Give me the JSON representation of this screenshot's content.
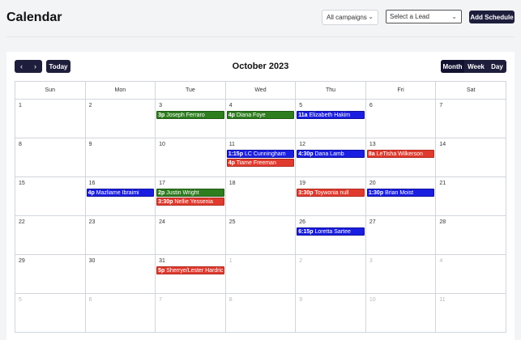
{
  "header": {
    "title": "Calendar",
    "campaigns_select": "All campaigns",
    "lead_select": "Select a Lead",
    "add_button": "Add Schedule"
  },
  "toolbar": {
    "prev_icon": "‹",
    "next_icon": "›",
    "today_label": "Today",
    "month_title": "October 2023",
    "views": [
      "Month",
      "Week",
      "Day"
    ],
    "active_view": "Month"
  },
  "weekdays": [
    "Sun",
    "Mon",
    "Tue",
    "Wed",
    "Thu",
    "Fri",
    "Sat"
  ],
  "colors": {
    "green": "#2e7d1f",
    "blue": "#1a1ee0",
    "red": "#e03a2e",
    "dark": "#1e1e3c"
  },
  "weeks": [
    [
      {
        "day": "1",
        "other": false,
        "events": []
      },
      {
        "day": "2",
        "other": false,
        "events": []
      },
      {
        "day": "3",
        "other": false,
        "events": [
          {
            "time": "3p",
            "name": "Joseph Ferraro",
            "color": "green"
          }
        ]
      },
      {
        "day": "4",
        "other": false,
        "events": [
          {
            "time": "4p",
            "name": "Diana Foye",
            "color": "green"
          }
        ]
      },
      {
        "day": "5",
        "other": false,
        "events": [
          {
            "time": "11a",
            "name": "Elizabeth Hakim",
            "color": "blue"
          }
        ]
      },
      {
        "day": "6",
        "other": false,
        "events": []
      },
      {
        "day": "7",
        "other": false,
        "events": []
      }
    ],
    [
      {
        "day": "8",
        "other": false,
        "events": []
      },
      {
        "day": "9",
        "other": false,
        "events": []
      },
      {
        "day": "10",
        "other": false,
        "events": []
      },
      {
        "day": "11",
        "other": false,
        "events": [
          {
            "time": "1:15p",
            "name": "LC Cunningham",
            "color": "blue"
          },
          {
            "time": "4p",
            "name": "Tiame Freeman",
            "color": "red"
          }
        ]
      },
      {
        "day": "12",
        "other": false,
        "events": [
          {
            "time": "4:30p",
            "name": "Dana Lamb",
            "color": "blue"
          }
        ]
      },
      {
        "day": "13",
        "other": false,
        "events": [
          {
            "time": "8a",
            "name": "LeTisha Wilkerson",
            "color": "red"
          }
        ]
      },
      {
        "day": "14",
        "other": false,
        "events": []
      }
    ],
    [
      {
        "day": "15",
        "other": false,
        "events": []
      },
      {
        "day": "16",
        "other": false,
        "events": [
          {
            "time": "4p",
            "name": "Mazliame Ibraimi",
            "color": "blue"
          }
        ]
      },
      {
        "day": "17",
        "other": false,
        "events": [
          {
            "time": "2p",
            "name": "Justin Wright",
            "color": "green"
          },
          {
            "time": "3:30p",
            "name": "Nellie Yessenia",
            "color": "red"
          }
        ]
      },
      {
        "day": "18",
        "other": false,
        "events": []
      },
      {
        "day": "19",
        "other": false,
        "events": [
          {
            "time": "3:30p",
            "name": "Toywonia null",
            "color": "red"
          }
        ]
      },
      {
        "day": "20",
        "other": false,
        "events": [
          {
            "time": "1:30p",
            "name": "Brian Moist",
            "color": "blue"
          }
        ]
      },
      {
        "day": "21",
        "other": false,
        "events": []
      }
    ],
    [
      {
        "day": "22",
        "other": false,
        "events": []
      },
      {
        "day": "23",
        "other": false,
        "events": []
      },
      {
        "day": "24",
        "other": false,
        "events": []
      },
      {
        "day": "25",
        "other": false,
        "events": []
      },
      {
        "day": "26",
        "other": false,
        "events": [
          {
            "time": "6:15p",
            "name": "Loretta Sartee",
            "color": "blue"
          }
        ]
      },
      {
        "day": "27",
        "other": false,
        "events": []
      },
      {
        "day": "28",
        "other": false,
        "events": []
      }
    ],
    [
      {
        "day": "29",
        "other": false,
        "events": []
      },
      {
        "day": "30",
        "other": false,
        "events": []
      },
      {
        "day": "31",
        "other": false,
        "events": [
          {
            "time": "5p",
            "name": "Sherryе/Lester Hardrick",
            "color": "red"
          }
        ]
      },
      {
        "day": "1",
        "other": true,
        "events": []
      },
      {
        "day": "2",
        "other": true,
        "events": []
      },
      {
        "day": "3",
        "other": true,
        "events": []
      },
      {
        "day": "4",
        "other": true,
        "events": []
      }
    ],
    [
      {
        "day": "5",
        "other": true,
        "events": []
      },
      {
        "day": "6",
        "other": true,
        "events": []
      },
      {
        "day": "7",
        "other": true,
        "events": []
      },
      {
        "day": "8",
        "other": true,
        "events": []
      },
      {
        "day": "9",
        "other": true,
        "events": []
      },
      {
        "day": "10",
        "other": true,
        "events": []
      },
      {
        "day": "11",
        "other": true,
        "events": []
      }
    ]
  ]
}
